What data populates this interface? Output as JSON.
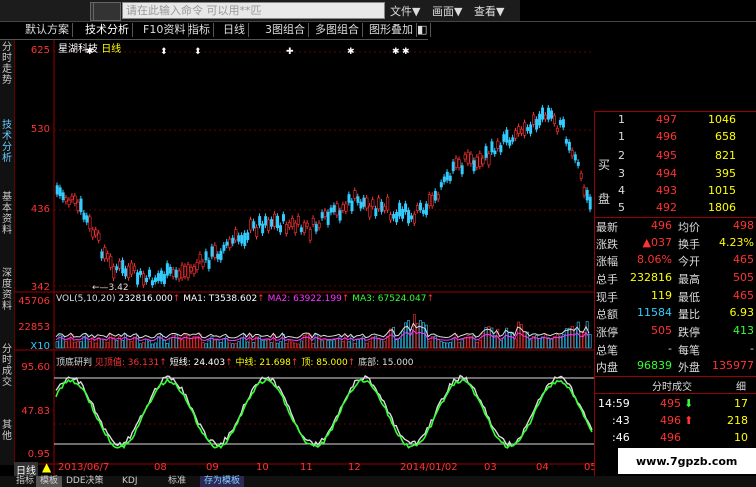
{
  "topbar": {
    "back": "⇦",
    "forward": "⇨",
    "search_placeholder": "请在此输入命令   可以用**匹",
    "menus": [
      "文件▼",
      "画面▼",
      "查看▼"
    ]
  },
  "toolbar": [
    "默认方案",
    "技术分析",
    "F10资料",
    "指标",
    "日线",
    "3图组合",
    "多图组合",
    "图形叠加",
    "◧"
  ],
  "left_tabs": [
    "分时走势",
    "技术分析",
    "基本资料",
    "深度资料",
    "分时成交",
    "其他"
  ],
  "stock": {
    "name": "星湖科技",
    "period": "日线"
  },
  "price_axis": [
    "625",
    "530",
    "436",
    "342"
  ],
  "low_marker": "3.42",
  "vol_legend": {
    "label": "VOL(5,10,20)",
    "v": "232816.000",
    "ma1": "MA1: T3538.602",
    "ma2": "MA2: 63922.199",
    "ma3": "MA3: 67524.047"
  },
  "vol_axis": [
    "45706",
    "22853",
    "X10"
  ],
  "ind_legend": {
    "label": "顶底研判",
    "a": "见顶值: 36.131",
    "b": "短线: 24.403",
    "c": "中线: 21.698",
    "d": "顶: 85.000",
    "e": "底部: 15.000"
  },
  "ind_axis": [
    "95.60",
    "47.83",
    "0.95"
  ],
  "date_axis": [
    "日线",
    "2013/06/7",
    "08",
    "09",
    "10",
    "11",
    "12",
    "2014/01/02",
    "03",
    "04",
    "05"
  ],
  "bottom_tabs": [
    "指标",
    "模板",
    "DDE决策",
    "KDJ",
    "标准",
    "存为模板"
  ],
  "orderbook": {
    "buy_label": "买盘",
    "rows": [
      {
        "n": "1",
        "price": "497",
        "vol": "1046"
      },
      {
        "n": "1",
        "price": "496",
        "vol": "658"
      },
      {
        "n": "2",
        "price": "495",
        "vol": "821"
      },
      {
        "n": "3",
        "price": "494",
        "vol": "395"
      },
      {
        "n": "4",
        "price": "493",
        "vol": "1015"
      },
      {
        "n": "5",
        "price": "492",
        "vol": "1806"
      }
    ]
  },
  "quote": [
    {
      "l1": "最新",
      "v1": "496",
      "l2": "均价",
      "v2": "498"
    },
    {
      "l1": "涨跌",
      "v1": "▲037",
      "l2": "换手",
      "v2": "4.23%"
    },
    {
      "l1": "涨幅",
      "v1": "8.06%",
      "l2": "今开",
      "v2": "465"
    },
    {
      "l1": "总手",
      "v1": "232816",
      "l2": "最高",
      "v2": "505"
    },
    {
      "l1": "现手",
      "v1": "119",
      "l2": "最低",
      "v2": "465"
    },
    {
      "l1": "总额",
      "v1": "11584",
      "l2": "量比",
      "v2": "6.93"
    },
    {
      "l1": "涨停",
      "v1": "505",
      "l2": "跌停",
      "v2": "413"
    },
    {
      "l1": "总笔",
      "v1": "-",
      "l2": "每笔",
      "v2": "-"
    },
    {
      "l1": "内盘",
      "v1": "96839",
      "l2": "外盘",
      "v2": "135977"
    }
  ],
  "trades": {
    "title": "分时成交",
    "detail": "细",
    "rows": [
      {
        "t": "14:59",
        "p": "495",
        "arrow": "⬇",
        "v": "17"
      },
      {
        "t": ":43",
        "p": "496",
        "arrow": "⬆",
        "v": "218"
      },
      {
        "t": ":46",
        "p": "496",
        "arrow": "",
        "v": "10"
      }
    ]
  },
  "watermark": "www.7gpzb.com"
}
